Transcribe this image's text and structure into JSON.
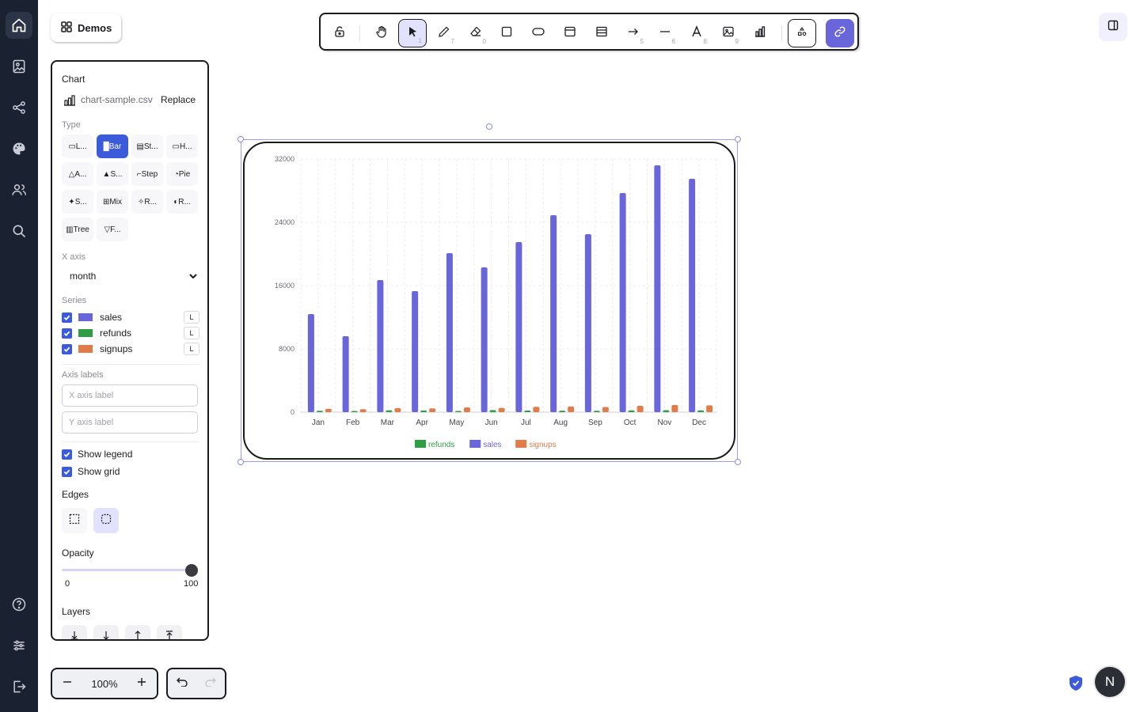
{
  "sidebar": {
    "items": [
      {
        "icon": "home-icon"
      },
      {
        "icon": "image-file-icon"
      },
      {
        "icon": "share-icon"
      },
      {
        "icon": "palette-icon"
      },
      {
        "icon": "users-icon"
      },
      {
        "icon": "search-icon"
      },
      {
        "icon": "help-icon"
      },
      {
        "icon": "settings-sliders-icon"
      },
      {
        "icon": "logout-icon"
      }
    ]
  },
  "demos_label": "Demos",
  "toolbar": {
    "keys": {
      "select": "1",
      "pen": "7",
      "eraser": "0",
      "arrow": "5",
      "line": "6",
      "text": "8",
      "image": "9"
    }
  },
  "props": {
    "section_title": "Chart",
    "file_name": "chart-sample.csv",
    "replace_label": "Replace",
    "type_label": "Type",
    "types": [
      {
        "label": "L...",
        "icon": "line-chart-icon"
      },
      {
        "label": "Bar",
        "icon": "bar-chart-icon",
        "active": true
      },
      {
        "label": "St...",
        "icon": "stacked-chart-icon"
      },
      {
        "label": "H...",
        "icon": "horizontal-bar-icon"
      },
      {
        "label": "A...",
        "icon": "area-chart-icon"
      },
      {
        "label": "S...",
        "icon": "stacked-area-icon"
      },
      {
        "label": "Step",
        "icon": "step-chart-icon"
      },
      {
        "label": "Pie",
        "icon": "pie-chart-icon"
      },
      {
        "label": "S...",
        "icon": "scatter-chart-icon"
      },
      {
        "label": "Mix",
        "icon": "mix-chart-icon"
      },
      {
        "label": "R...",
        "icon": "radar-chart-icon"
      },
      {
        "label": "R...",
        "icon": "radial-chart-icon"
      },
      {
        "label": "Tree",
        "icon": "treemap-icon"
      },
      {
        "label": "F...",
        "icon": "funnel-chart-icon"
      }
    ],
    "x_axis_label": "X axis",
    "x_axis_value": "month",
    "series_label": "Series",
    "series": [
      {
        "name": "sales",
        "color": "#6965db",
        "axis": "L"
      },
      {
        "name": "refunds",
        "color": "#2f9e44",
        "axis": "L"
      },
      {
        "name": "signups",
        "color": "#e07b4a",
        "axis": "L"
      }
    ],
    "axis_labels_title": "Axis labels",
    "x_axis_placeholder": "X axis label",
    "y_axis_placeholder": "Y axis label",
    "show_legend": "Show legend",
    "show_grid": "Show grid",
    "edges_title": "Edges",
    "opacity_title": "Opacity",
    "opacity_min": "0",
    "opacity_max": "100",
    "opacity_value": 100,
    "layers_title": "Layers"
  },
  "zoom": {
    "value": "100%"
  },
  "user_initial": "N",
  "chart_data": {
    "type": "bar",
    "categories": [
      "Jan",
      "Feb",
      "Mar",
      "Apr",
      "May",
      "Jun",
      "Jul",
      "Aug",
      "Sep",
      "Oct",
      "Nov",
      "Dec"
    ],
    "series": [
      {
        "name": "sales",
        "color": "#6965db",
        "values": [
          12400,
          9600,
          16700,
          15300,
          20100,
          18300,
          21500,
          24900,
          22500,
          27700,
          31200,
          29500
        ]
      },
      {
        "name": "refunds",
        "color": "#2f9e44",
        "values": [
          180,
          150,
          240,
          210,
          140,
          260,
          200,
          190,
          170,
          220,
          250,
          230
        ]
      },
      {
        "name": "signups",
        "color": "#e07b4a",
        "values": [
          420,
          380,
          510,
          470,
          600,
          540,
          680,
          720,
          650,
          800,
          910,
          860
        ]
      }
    ],
    "yticks": [
      "0",
      "8000",
      "16000",
      "24000",
      "32000"
    ],
    "ylim": [
      0,
      32000
    ],
    "grid": true,
    "legend_position": "bottom",
    "legend": [
      {
        "name": "refunds",
        "color": "#2f9e44"
      },
      {
        "name": "sales",
        "color": "#6965db"
      },
      {
        "name": "signups",
        "color": "#e07b4a"
      }
    ]
  }
}
